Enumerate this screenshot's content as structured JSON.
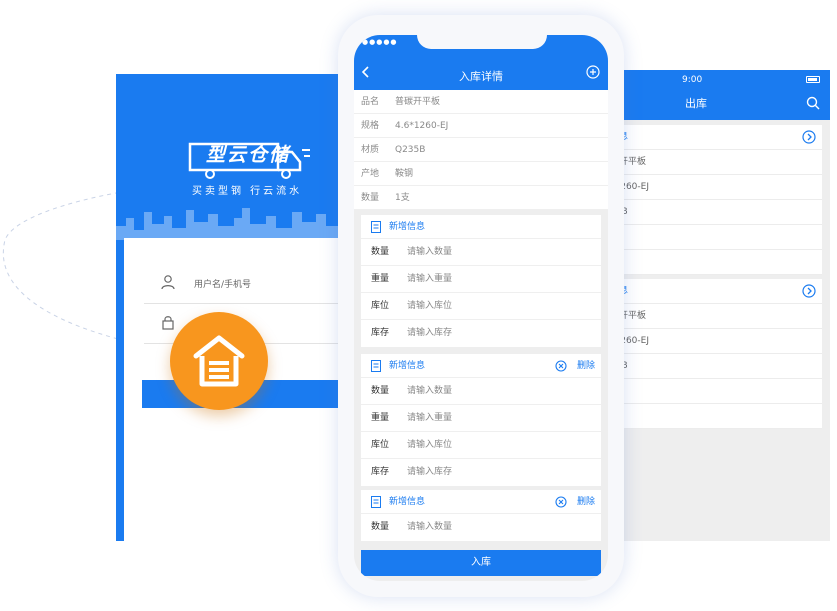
{
  "login": {
    "logo_text": "型云仓储",
    "slogan": "买卖型钢 行云流水",
    "username_placeholder": "用户名/手机号",
    "password_placeholder": "",
    "login_button_label": ""
  },
  "inbound": {
    "status_signal": "●●●●● ",
    "title": "入库详情",
    "specs": [
      {
        "key": "品名",
        "value": "普碳开平板"
      },
      {
        "key": "规格",
        "value": "4.6*1260-EJ"
      },
      {
        "key": "材质",
        "value": "Q235B"
      },
      {
        "key": "产地",
        "value": "鞍钢"
      },
      {
        "key": "数量",
        "value": "1支"
      }
    ],
    "blocks": [
      {
        "title": "新增信息",
        "delete_label": "",
        "rows": [
          {
            "key": "数量",
            "value": "请输入数量"
          },
          {
            "key": "重量",
            "value": "请输入重量"
          },
          {
            "key": "库位",
            "value": "请输入库位"
          },
          {
            "key": "库存",
            "value": "请输入库存"
          }
        ]
      },
      {
        "title": "新增信息",
        "delete_label": "删除",
        "rows": [
          {
            "key": "数量",
            "value": "请输入数量"
          },
          {
            "key": "重量",
            "value": "请输入重量"
          },
          {
            "key": "库位",
            "value": "请输入库位"
          },
          {
            "key": "库存",
            "value": "请输入库存"
          }
        ]
      },
      {
        "title": "新增信息",
        "delete_label": "删除",
        "rows": [
          {
            "key": "数量",
            "value": "请输入数量"
          }
        ]
      }
    ],
    "submit_label": "入库"
  },
  "outbound": {
    "time": "9:00",
    "title": "出库",
    "panels": [
      {
        "head": "言息",
        "rows": [
          "亘开平板",
          "*1260-EJ",
          "35B",
          "刚",
          ""
        ]
      },
      {
        "head": "言息",
        "rows": [
          "亘开平板",
          "*1260-EJ",
          "35B",
          "刚",
          ""
        ]
      }
    ]
  },
  "colors": {
    "primary": "#1a7bf0",
    "accent_orange": "#f8961e",
    "background": "#eeeeee"
  }
}
